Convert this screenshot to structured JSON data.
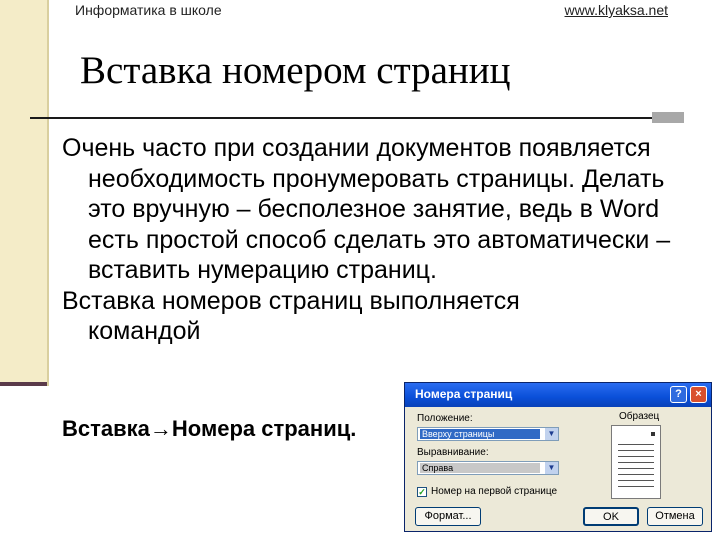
{
  "header": {
    "left": "Информатика в школе",
    "right": "www.klyaksa.net"
  },
  "slide": {
    "title": "Вставка номером страниц",
    "paragraphs": [
      "Очень часто при создании документов появляется необходимость пронумеровать страницы. Делать это вручную – бесполезное занятие, ведь в Word есть простой способ сделать это автоматически – вставить нумерацию страниц.",
      "Вставка номеров страниц выполняется командой"
    ],
    "command": "Вставка→Номера страниц."
  },
  "dialog": {
    "title": "Номера страниц",
    "help_glyph": "?",
    "close_glyph": "×",
    "position_label": "Положение:",
    "position_value": "Вверху страницы",
    "alignment_label": "Выравнивание:",
    "alignment_value": "Справа",
    "first_page_label": "Номер на первой странице",
    "first_page_checked": true,
    "preview_label": "Образец",
    "format_button": "Формат...",
    "ok_button": "OK",
    "cancel_button": "Отмена"
  },
  "colors": {
    "left_band": "#f4ecc8",
    "titlebar": "#0a4fd8",
    "selection": "#316ac5"
  }
}
